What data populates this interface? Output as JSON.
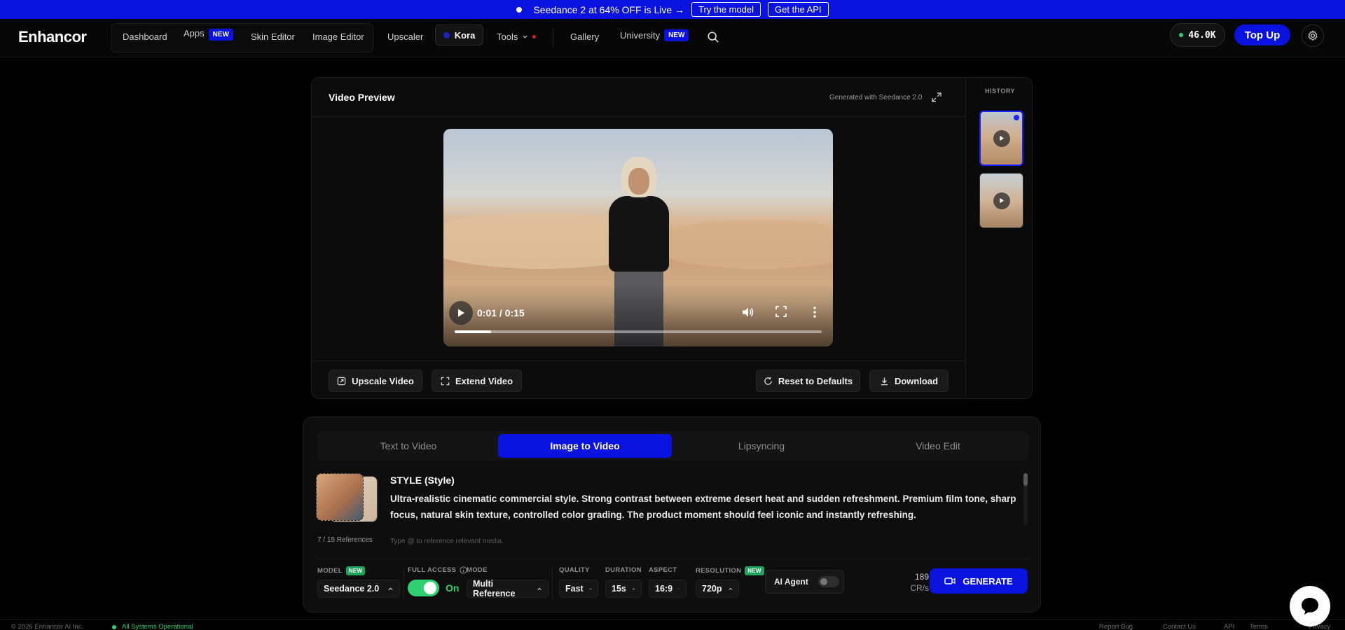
{
  "promo": {
    "text": "Seedance 2 at 64% OFF is Live →",
    "try_label": "Try the model",
    "api_label": "Get the API"
  },
  "nav": {
    "logo": "Enhancor",
    "links": {
      "dashboard": "Dashboard",
      "apps": "Apps",
      "skin_editor": "Skin Editor",
      "image_editor": "Image Editor",
      "upscaler": "Upscaler",
      "kora": "Kora",
      "tools": "Tools",
      "gallery": "Gallery",
      "university": "University"
    },
    "new_badge": "NEW",
    "credits": "46.0K",
    "topup_label": "Top Up"
  },
  "preview": {
    "title": "Video Preview",
    "generated_with": "Generated with Seedance 2.0",
    "history_title": "HISTORY",
    "video": {
      "time": "0:01 / 0:15",
      "progress_fraction": 0.1
    },
    "actions": {
      "upscale": "Upscale Video",
      "extend": "Extend Video",
      "reset": "Reset to Defaults",
      "download": "Download"
    }
  },
  "generator": {
    "tabs": [
      "Text to Video",
      "Image to Video",
      "Lipsyncing",
      "Video Edit"
    ],
    "active_tab": "Image to Video",
    "style_title": "STYLE (Style)",
    "style_text": "Ultra-realistic cinematic commercial style. Strong contrast between extreme desert heat and sudden refreshment. Premium film tone, sharp focus, natural skin texture, controlled color grading. The product moment should feel iconic and instantly refreshing.",
    "references": "7 / 15 References",
    "hint": "Type @ to reference relevant media.",
    "options": {
      "model": {
        "label": "MODEL",
        "value": "Seedance 2.0",
        "badge": "NEW"
      },
      "full_access": {
        "label": "FULL ACCESS",
        "value": "On"
      },
      "mode": {
        "label": "MODE",
        "value": "Multi Reference"
      },
      "quality": {
        "label": "QUALITY",
        "value": "Fast"
      },
      "duration": {
        "label": "DURATION",
        "value": "15s"
      },
      "aspect": {
        "label": "ASPECT",
        "value": "16:9"
      },
      "resolution": {
        "label": "RESOLUTION",
        "value": "720p",
        "badge": "NEW"
      }
    },
    "ai_agent_label": "AI Agent",
    "cost": {
      "value": "189",
      "unit": "CR/s"
    },
    "generate_label": "GENERATE"
  },
  "footer": {
    "copyright": "© 2026 Enhancor AI Inc.",
    "status": "All Systems Operational",
    "links": [
      "Report Bug",
      "Contact Us",
      "API",
      "Terms",
      "Privacy"
    ]
  },
  "colors": {
    "accent": "#0a12e0",
    "success": "#2fd070"
  }
}
